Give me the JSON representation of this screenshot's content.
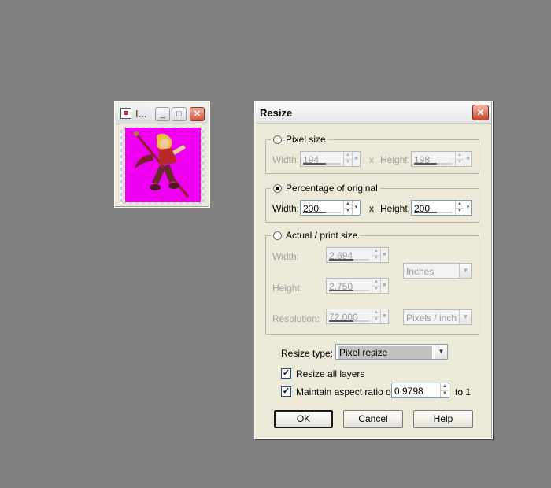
{
  "image_window": {
    "title": "I...",
    "buttons": {
      "minimize": "_",
      "maximize": "□",
      "close": "✕"
    }
  },
  "dialog": {
    "title": "Resize",
    "close_glyph": "✕",
    "pixel_size": {
      "label": "Pixel size",
      "width_label": "Width:",
      "width_value": "194",
      "x_label": "x",
      "height_label": "Height:",
      "height_value": "198"
    },
    "percentage": {
      "label": "Percentage of original",
      "width_label": "Width:",
      "width_value": "200",
      "x_label": "x",
      "height_label": "Height:",
      "height_value": "200"
    },
    "actual": {
      "label": "Actual / print size",
      "width_label": "Width:",
      "width_value": "2.694",
      "height_label": "Height:",
      "height_value": "2.750",
      "resolution_label": "Resolution:",
      "resolution_value": "72.000",
      "units_value": "Inches",
      "res_units_value": "Pixels / inch"
    },
    "resize_type": {
      "label": "Resize type:",
      "value": "Pixel resize"
    },
    "resize_all_layers": {
      "label": "Resize all layers",
      "checked": true
    },
    "aspect": {
      "label": "Maintain aspect ratio of:",
      "value": "0.9798",
      "suffix": "to 1",
      "checked": true
    },
    "buttons": {
      "ok": "OK",
      "cancel": "Cancel",
      "help": "Help"
    }
  }
}
